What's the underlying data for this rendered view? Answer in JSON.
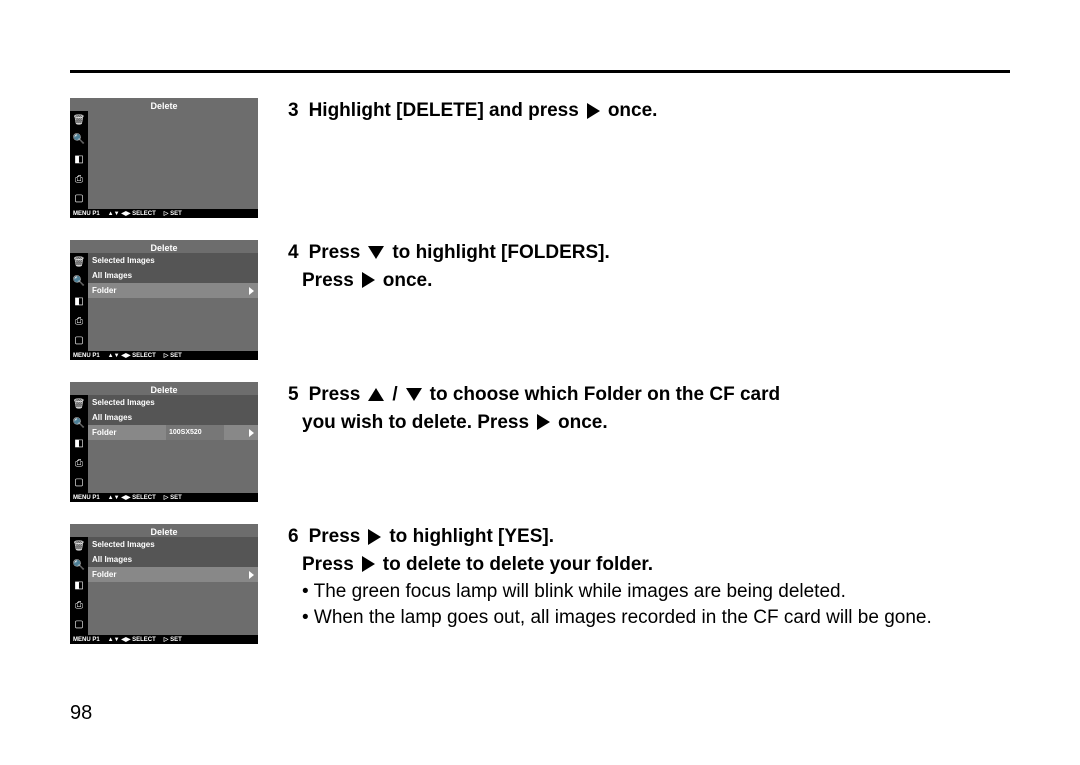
{
  "page_number": "98",
  "steps": {
    "s3": {
      "num": "3",
      "t1": "Highlight [DELETE] and press",
      "t2": "once."
    },
    "s4": {
      "num": "4",
      "t1": "Press",
      "t2": "to highlight [FOLDERS].",
      "t3": "Press",
      "t4": "once."
    },
    "s5": {
      "num": "5",
      "t1": "Press",
      "slash": "/",
      "t2": "to choose which Folder on the CF card",
      "t3": "you wish to delete. Press",
      "t4": "once."
    },
    "s6": {
      "num": "6",
      "t1": "Press",
      "t2": "to highlight [YES].",
      "t3": "Press",
      "t4": "to delete to delete your folder."
    }
  },
  "bullets": {
    "b1": "• The green focus lamp will blink while images are being deleted.",
    "b2": "• When the lamp goes out, all images recorded in the CF card will be gone."
  },
  "lcd": {
    "title": "Delete",
    "menu": {
      "sel_images": "Selected Images",
      "all_images": "All Images",
      "folder": "Folder",
      "folder_val": "100SX520"
    },
    "footer": {
      "menu": "MENU P1",
      "select": "▲▼  ◀▶ SELECT",
      "set": "▷ SET"
    }
  }
}
